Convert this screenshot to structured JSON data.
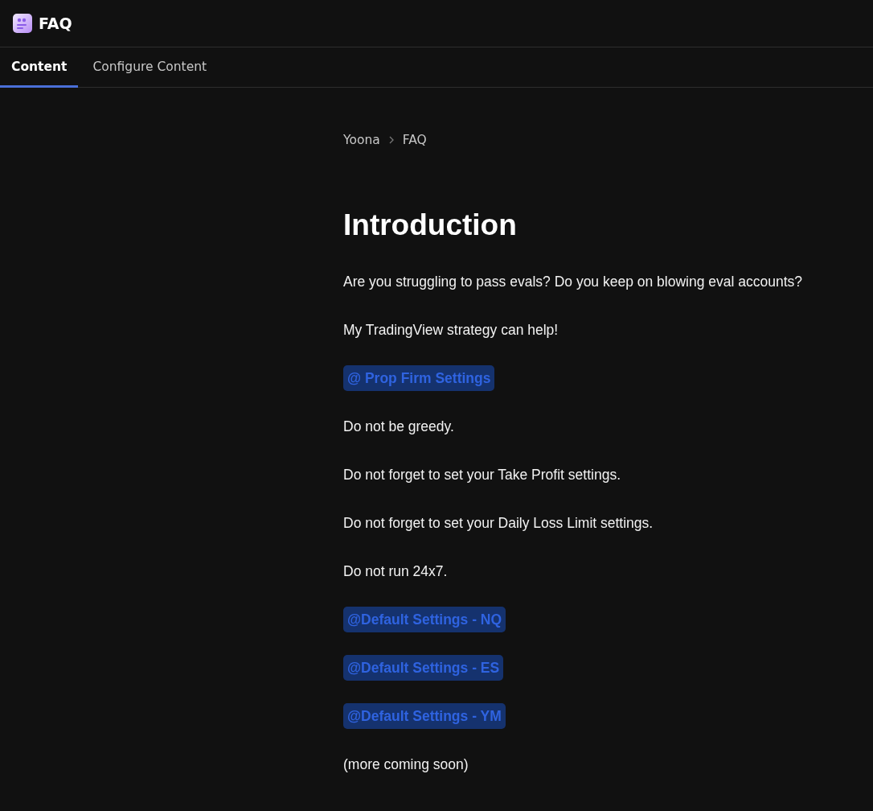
{
  "app": {
    "title": "FAQ"
  },
  "tabs": [
    {
      "label": "Content",
      "selected": true
    },
    {
      "label": "Configure Content",
      "selected": false
    }
  ],
  "breadcrumb": [
    "Yoona",
    "FAQ"
  ],
  "heading": "Introduction",
  "blocks": [
    {
      "kind": "paragraph",
      "text": "Are you struggling to pass evals? Do you keep on blowing eval accounts?"
    },
    {
      "kind": "paragraph",
      "text": "My TradingView strategy can help!"
    },
    {
      "kind": "mention",
      "text": "@ Prop Firm Settings"
    },
    {
      "kind": "paragraph",
      "text": "Do not be greedy."
    },
    {
      "kind": "paragraph",
      "text": "Do not forget to set your Take Profit settings."
    },
    {
      "kind": "paragraph",
      "text": "Do not forget to set your Daily Loss Limit settings."
    },
    {
      "kind": "paragraph",
      "text": "Do not run 24x7."
    },
    {
      "kind": "mention",
      "text": "@Default Settings - NQ"
    },
    {
      "kind": "mention",
      "text": "@Default Settings - ES"
    },
    {
      "kind": "mention",
      "text": "@Default Settings - YM"
    },
    {
      "kind": "paragraph",
      "text": "(more coming soon)"
    }
  ]
}
